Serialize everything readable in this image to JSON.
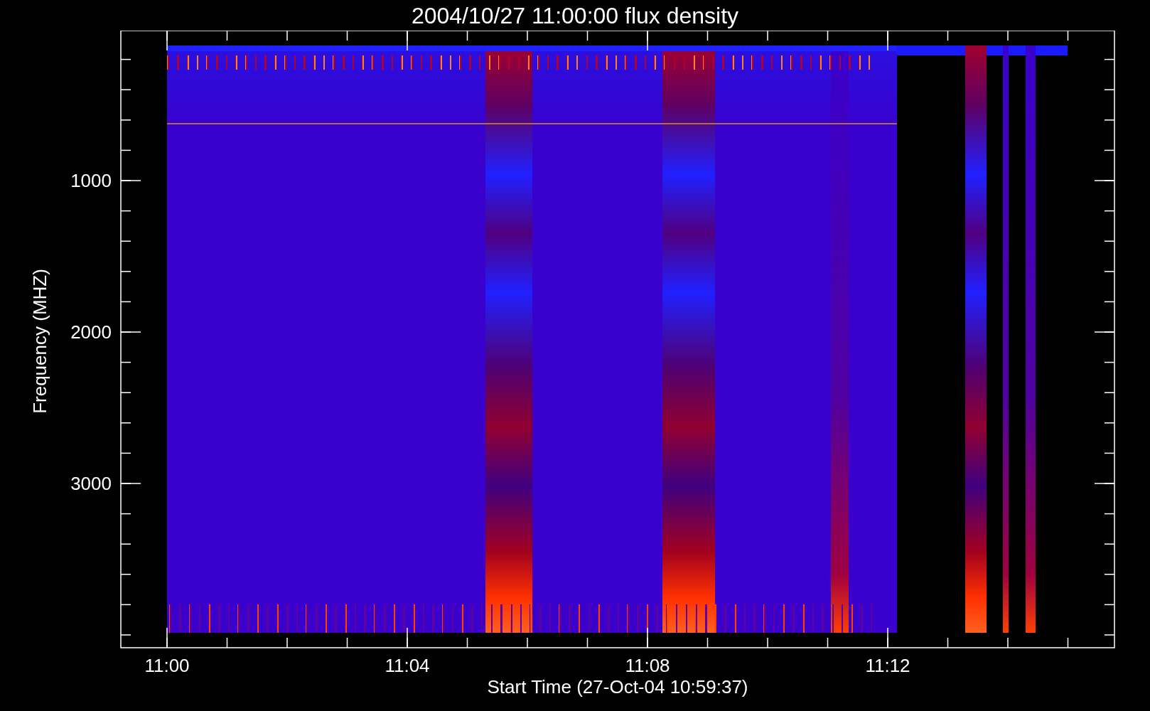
{
  "title": "2004/10/27 11:00:00 flux density",
  "plot": {
    "ylabel": "Frequency (MHZ)",
    "xlabel": "Start Time (27-Oct-04 10:59:37)",
    "yticks": [
      "1000",
      "2000",
      "3000"
    ],
    "xticks": [
      "11:00",
      "11:04",
      "11:08",
      "11:12"
    ]
  }
}
